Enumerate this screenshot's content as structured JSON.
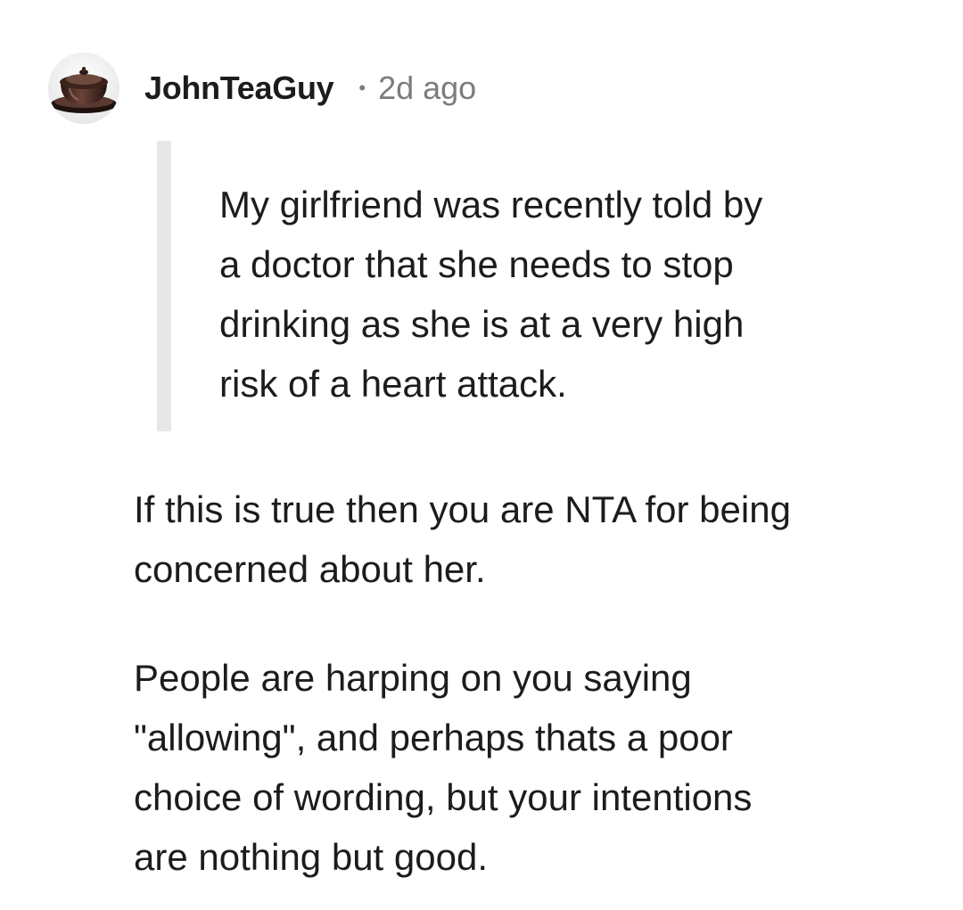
{
  "comment": {
    "author": "JohnTeaGuy",
    "separator": "•",
    "time": "2d ago",
    "avatar_icon": "teacup-icon",
    "quote": "My girlfriend was recently told by\na doctor that she needs to stop\ndrinking as she is at a very high\nrisk of a heart attack.",
    "paragraphs": [
      "If this is true then you are NTA for being\nconcerned about her.",
      "People are harping on you saying\n\"allowing\", and perhaps thats a poor\nchoice of wording, but your intentions\nare nothing but good."
    ]
  },
  "colors": {
    "text": "#1c1c1c",
    "meta": "#7c7c7c",
    "quote_bar": "#e7e7e7",
    "background": "#ffffff"
  }
}
